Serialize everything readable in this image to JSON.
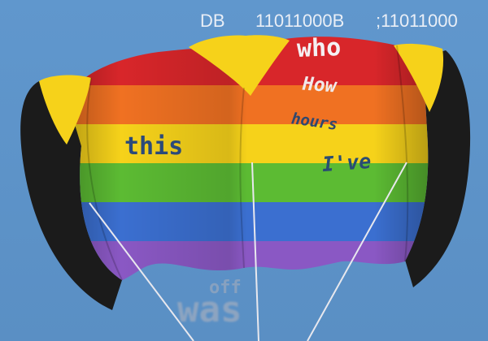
{
  "header": {
    "label_db": "DB",
    "binary_1": "11011000B",
    "binary_2": ";11011000"
  },
  "overlay_words": {
    "who": "who",
    "how": "How",
    "this": "this",
    "hours": "hours",
    "ive": "I've",
    "off": "off",
    "was": "was"
  },
  "colors": {
    "sky": "#5d93c9",
    "red": "#d8262a",
    "orange": "#f07122",
    "yellow": "#f6d21a",
    "green": "#5cbb33",
    "blue": "#3b6fd0",
    "purple": "#8a58c4",
    "black": "#1b1b1b"
  }
}
